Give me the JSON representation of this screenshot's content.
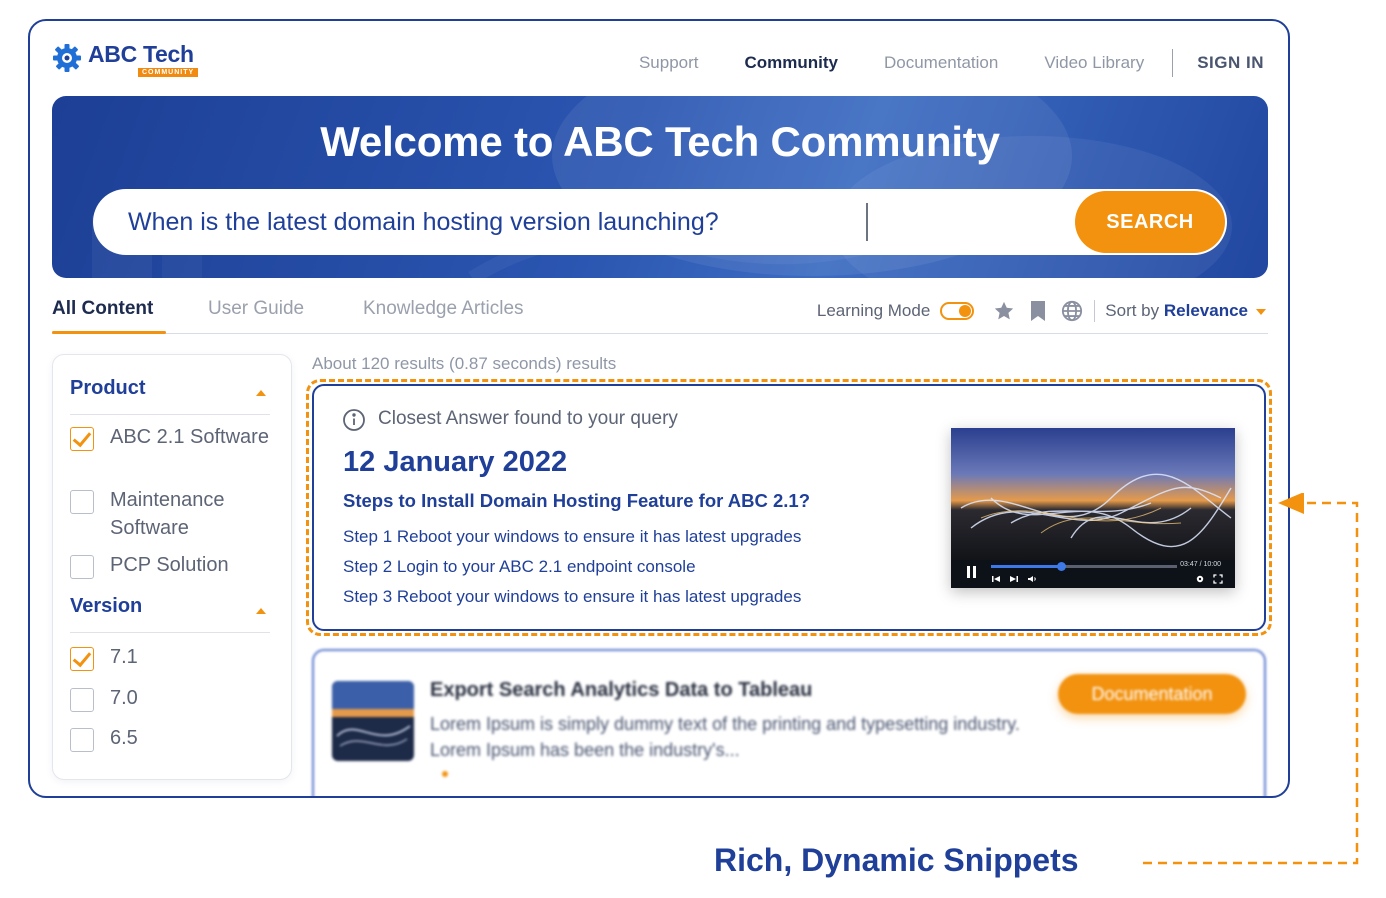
{
  "brand": {
    "name": "ABC Tech",
    "tagline": "COMMUNITY"
  },
  "nav": {
    "items": [
      {
        "label": "Support",
        "active": false
      },
      {
        "label": "Community",
        "active": true
      },
      {
        "label": "Documentation",
        "active": false
      },
      {
        "label": "Video Library",
        "active": false
      }
    ],
    "signin": "SIGN IN"
  },
  "hero": {
    "title": "Welcome to ABC Tech Community",
    "search_value": "When is the latest domain hosting version launching?",
    "search_button": "SEARCH"
  },
  "tabs": [
    {
      "label": "All Content",
      "active": true
    },
    {
      "label": "User Guide",
      "active": false
    },
    {
      "label": "Knowledge Articles",
      "active": false
    }
  ],
  "toolbar": {
    "learning_mode": "Learning Mode",
    "learning_mode_on": true,
    "sort_prefix": "Sort by",
    "sort_value": "Relevance"
  },
  "filters": {
    "product": {
      "title": "Product",
      "options": [
        {
          "label": "ABC 2.1 Software",
          "checked": true
        },
        {
          "label": "Maintenance Software",
          "checked": false
        },
        {
          "label": "PCP Solution",
          "checked": false
        }
      ]
    },
    "version": {
      "title": "Version",
      "options": [
        {
          "label": "7.1",
          "checked": true
        },
        {
          "label": "7.0",
          "checked": false
        },
        {
          "label": "6.5",
          "checked": false
        }
      ]
    }
  },
  "results": {
    "count_text": "About 120 results (0.87 seconds) results",
    "answer": {
      "kicker": "Closest Answer found to your query",
      "date": "12 January 2022",
      "question": "Steps to Install Domain Hosting Feature for ABC 2.1?",
      "steps": [
        "Step 1 Reboot your windows to ensure it has latest upgrades",
        "Step 2 Login to your ABC 2.1 endpoint console",
        "Step 3 Reboot your windows to ensure it has latest upgrades"
      ],
      "video": {
        "time": "03:47 / 10:00",
        "progress": 0.379
      }
    },
    "second": {
      "title": "Export Search Analytics Data to Tableau",
      "text": "Lorem Ipsum is simply dummy text of the printing and typesetting industry. Lorem Ipsum has been the industry's...",
      "badge": "Documentation"
    }
  },
  "annotation": {
    "label": "Rich, Dynamic Snippets"
  },
  "colors": {
    "brand_blue": "#1f3f99",
    "accent_orange": "#f2920f",
    "muted_text": "#8f97a6"
  },
  "icons": [
    "gear-logo-icon",
    "info-icon",
    "star-icon",
    "bookmark-icon",
    "globe-icon",
    "pause-icon",
    "skip-back-icon",
    "skip-forward-icon",
    "volume-icon",
    "settings-icon",
    "fullscreen-icon",
    "arrow-left-icon"
  ]
}
